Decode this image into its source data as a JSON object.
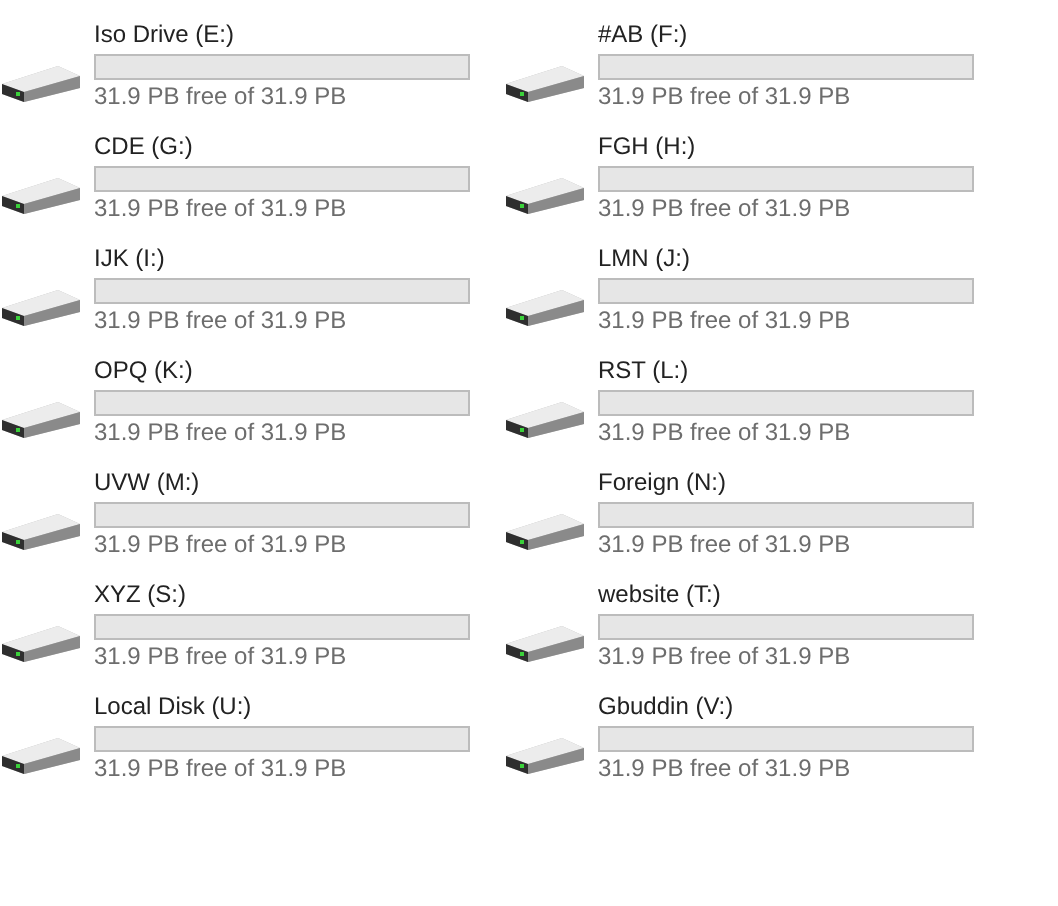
{
  "drives": [
    {
      "name": "Iso Drive (E:)",
      "level": 0,
      "free": "31.9 PB free of 31.9 PB"
    },
    {
      "name": "#AB (F:)",
      "level": 0,
      "free": "31.9 PB free of 31.9 PB"
    },
    {
      "name": "CDE (G:)",
      "level": 0,
      "free": "31.9 PB free of 31.9 PB"
    },
    {
      "name": "FGH (H:)",
      "level": 0,
      "free": "31.9 PB free of 31.9 PB"
    },
    {
      "name": "IJK (I:)",
      "level": 0,
      "free": "31.9 PB free of 31.9 PB"
    },
    {
      "name": "LMN (J:)",
      "level": 0,
      "free": "31.9 PB free of 31.9 PB"
    },
    {
      "name": "OPQ (K:)",
      "level": 0,
      "free": "31.9 PB free of 31.9 PB"
    },
    {
      "name": "RST (L:)",
      "level": 0,
      "free": "31.9 PB free of 31.9 PB"
    },
    {
      "name": "UVW (M:)",
      "level": 0,
      "free": "31.9 PB free of 31.9 PB"
    },
    {
      "name": "Foreign (N:)",
      "level": 0,
      "free": "31.9 PB free of 31.9 PB"
    },
    {
      "name": "XYZ (S:)",
      "level": 0,
      "free": "31.9 PB free of 31.9 PB"
    },
    {
      "name": "website (T:)",
      "level": 0,
      "free": "31.9 PB free of 31.9 PB"
    },
    {
      "name": "Local Disk (U:)",
      "level": 0,
      "free": "31.9 PB free of 31.9 PB"
    },
    {
      "name": "Gbuddin (V:)",
      "level": 0,
      "free": "31.9 PB free of 31.9 PB"
    }
  ]
}
